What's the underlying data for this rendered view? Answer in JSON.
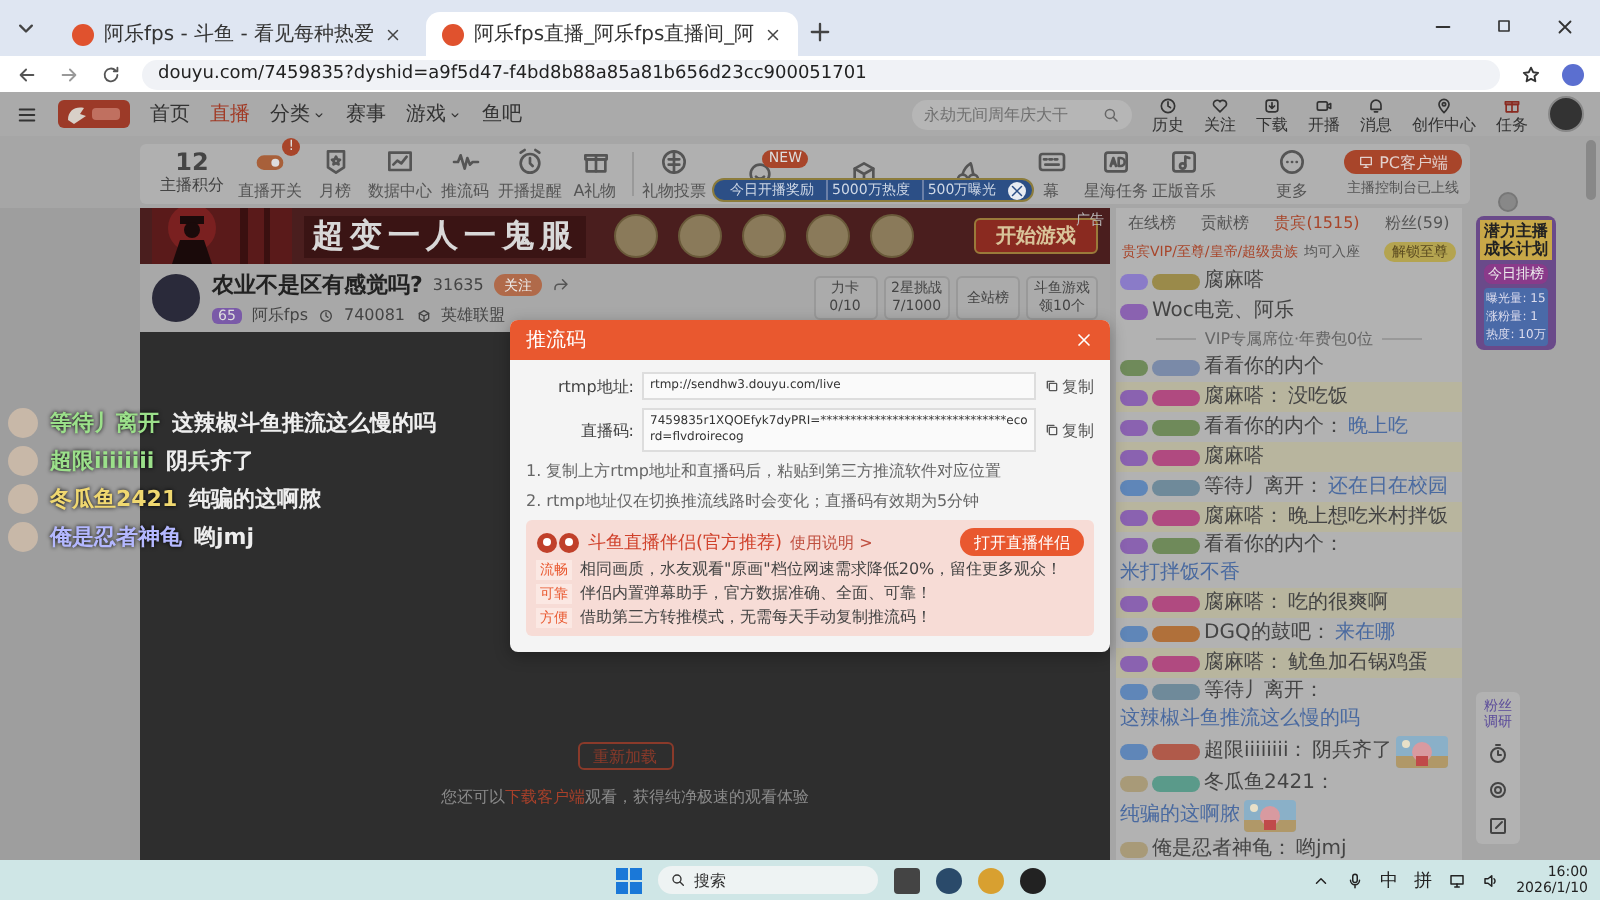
{
  "browser": {
    "tabs": [
      {
        "title": "阿乐fps - 斗鱼 - 看见每种热爱",
        "selected": false
      },
      {
        "title": "阿乐fps直播_阿乐fps直播间_阿",
        "selected": true
      }
    ],
    "url": "douyu.com/7459835?dyshid=a9f5d47-f4bd8b88a85a81b656d23cc900051701"
  },
  "site_header": {
    "nav": [
      {
        "label": "首页",
        "selected": false,
        "dropdown": false
      },
      {
        "label": "直播",
        "selected": true,
        "dropdown": false
      },
      {
        "label": "分类",
        "selected": false,
        "dropdown": true
      },
      {
        "label": "赛事",
        "selected": false,
        "dropdown": false
      },
      {
        "label": "游戏",
        "selected": false,
        "dropdown": true
      },
      {
        "label": "鱼吧",
        "selected": false,
        "dropdown": false
      }
    ],
    "search": {
      "placeholder": "永劫无间周年庆大干"
    },
    "actions": [
      {
        "label": "历史",
        "kind": "clock"
      },
      {
        "label": "关注",
        "kind": "heart"
      },
      {
        "label": "下载",
        "kind": "download"
      },
      {
        "label": "开播",
        "kind": "camera"
      },
      {
        "label": "消息",
        "kind": "bell"
      },
      {
        "label": "创作中心",
        "kind": "pin"
      },
      {
        "label": "任务",
        "kind": "gift"
      }
    ]
  },
  "toolbar": {
    "score": {
      "value": "12",
      "label": "主播积分"
    },
    "items": [
      {
        "label": "直播开关",
        "kind": "toggle",
        "badge": "!"
      },
      {
        "label": "月榜",
        "kind": "medal"
      },
      {
        "label": "数据中心",
        "kind": "chart"
      },
      {
        "label": "推流码",
        "kind": "wave"
      },
      {
        "label": "开播提醒",
        "kind": "alarm"
      },
      {
        "label": "A礼物",
        "kind": "gift"
      },
      {
        "label": "礼物投票",
        "kind": "vote"
      },
      {
        "kind": "face",
        "badge": "NEW"
      },
      {
        "kind": "box"
      },
      {
        "kind": "cherries"
      },
      {
        "label": "幕",
        "kind": "keyboard"
      },
      {
        "label": "星海任务",
        "kind": "ad"
      },
      {
        "label": "正版音乐",
        "kind": "music"
      }
    ],
    "popup": [
      "今日开播奖励",
      "5000万热度",
      "500万曝光"
    ],
    "more": "更多",
    "pc_button": "PC客户端",
    "pc_note": "主播控制台已上线"
  },
  "banner": {
    "title": "超变一人一鬼服",
    "button": "开始游戏",
    "ad_label": "广告"
  },
  "streamer": {
    "title": "农业不是区有感觉吗?",
    "followers": "31635",
    "follow_button": "关注",
    "level": "65",
    "name": "阿乐fps",
    "viewers": "740081",
    "category": "英雄联盟",
    "stats": [
      {
        "label": "力卡",
        "value": "0/10"
      },
      {
        "label": "2星挑战",
        "value": "7/1000"
      },
      {
        "label": "全站榜"
      },
      {
        "label": "斗鱼游戏",
        "value": "领10个"
      }
    ]
  },
  "danmu": [
    {
      "user": "等待丿离开",
      "message": "这辣椒斗鱼推流这么慢的吗",
      "color": "#9be08a"
    },
    {
      "user": "超限iiiiiiii",
      "message": "阴兵齐了",
      "color": "#9be08a"
    },
    {
      "user": "冬瓜鱼2421",
      "message": "纯骗的这啊脓",
      "color": "#f0d870"
    },
    {
      "user": "俺是忍者神龟",
      "message": "哟jmj",
      "color": "#b4b8ff"
    }
  ],
  "player": {
    "reload_button": "重新加载",
    "hint_before": "您还可以",
    "hint_link": "下载客户端",
    "hint_after": "观看，获得纯净极速的观看体验"
  },
  "modal": {
    "title": "推流码",
    "fields": [
      {
        "label": "rtmp地址:",
        "value": "rtmp://sendhw3.douyu.com/live",
        "copy": "复制"
      },
      {
        "label": "直播码:",
        "value": "7459835r1XQOEfyk7dyPRI=*******************************ecord=flvdroirecog",
        "copy": "复制"
      }
    ],
    "notes": [
      "1. 复制上方rtmp地址和直播码后，粘贴到第三方推流软件对应位置",
      "2. rtmp地址仅在切换推流线路时会变化；直播码有效期为5分钟"
    ],
    "promo": {
      "title": "斗鱼直播伴侣(官方推荐)",
      "help": "使用说明 >",
      "button": "打开直播伴侣",
      "features": [
        {
          "tag": "流畅",
          "text": "相同画质，水友观看\"原画\"档位网速需求降低20%，留住更多观众！"
        },
        {
          "tag": "可靠",
          "text": "伴侣内置弹幕助手，官方数据准确、全面、可靠！"
        },
        {
          "tag": "方便",
          "text": "借助第三方转推模式，无需每天手动复制推流码！"
        }
      ]
    }
  },
  "chat": {
    "tabs": [
      {
        "label": "在线榜",
        "selected": false
      },
      {
        "label": "贡献榜",
        "selected": false
      },
      {
        "label": "贵宾(1515)",
        "selected": true
      },
      {
        "label": "粉丝(59)",
        "selected": false
      }
    ],
    "notice": "贵宾VIP/至尊/皇帝/超级贵族",
    "notice_tail": "均可入座",
    "unlock_button": "解锁至尊",
    "messages": [
      {
        "kind": "enter",
        "user": "腐麻嗒",
        "badges": [
          {
            "color": "#8a7bc8"
          },
          {
            "color": "#9a8a4a"
          }
        ],
        "vip": false
      },
      {
        "kind": "enter",
        "user": "Woc电竞、阿乐",
        "badges": [
          {
            "color": "#8a62b0"
          }
        ],
        "vip": false
      },
      {
        "kind": "divider",
        "text": "VIP专属席位·年费包0位"
      },
      {
        "kind": "message",
        "user": "看看你的内个",
        "badges": [
          {
            "color": "#6f8a5a"
          },
          {
            "color": "#7a8aa8"
          }
        ],
        "vip": false
      },
      {
        "kind": "message",
        "user": "腐麻嗒：",
        "text": "没吃饭",
        "badges": [
          {
            "color": "#8a62b0"
          },
          {
            "color": "#b04a80"
          }
        ],
        "highlight": false,
        "vip": true
      },
      {
        "kind": "message",
        "user": "看看你的内个：",
        "text": "晚上吃",
        "badges": [
          {
            "color": "#8a62b0"
          },
          {
            "color": "#6f8a5a"
          }
        ],
        "highlight": true
      },
      {
        "kind": "message",
        "user": "腐麻嗒",
        "badges": [
          {
            "color": "#8a62b0"
          },
          {
            "color": "#b04a80"
          }
        ],
        "vip": true
      },
      {
        "kind": "message",
        "user": "等待丿离开：",
        "text": "还在日在校园",
        "badges": [
          {
            "color": "#5f86b8"
          },
          {
            "color": "#6f8a9a"
          }
        ],
        "highlight": true
      },
      {
        "kind": "message",
        "user": "腐麻嗒：",
        "text": "晚上想吃米村拌饭",
        "badges": [
          {
            "color": "#8a62b0"
          },
          {
            "color": "#b04a80"
          }
        ],
        "highlight": false,
        "vip": true
      },
      {
        "kind": "message",
        "user": "看看你的内个：",
        "text": "米打拌饭不香",
        "badges": [
          {
            "color": "#8a62b0"
          },
          {
            "color": "#6f8a5a"
          }
        ],
        "highlight": true
      },
      {
        "kind": "message",
        "user": "腐麻嗒：",
        "text": "吃的很爽啊",
        "badges": [
          {
            "color": "#8a62b0"
          },
          {
            "color": "#b04a80"
          }
        ],
        "highlight": false,
        "vip": true
      },
      {
        "kind": "message",
        "user": "DGQ的鼓吧：",
        "text": "来在哪",
        "badges": [
          {
            "color": "#5f86b8"
          },
          {
            "color": "#b0703a"
          }
        ],
        "highlight": true
      },
      {
        "kind": "message",
        "user": "腐麻嗒：",
        "text": "鱿鱼加石锅鸡蛋",
        "badges": [
          {
            "color": "#8a62b0"
          },
          {
            "color": "#b04a80"
          }
        ],
        "highlight": false,
        "vip": true
      },
      {
        "kind": "message",
        "user": "等待丿离开：",
        "text": "这辣椒斗鱼推流这么慢的吗",
        "badges": [
          {
            "color": "#5f86b8"
          },
          {
            "color": "#6f8a9a"
          }
        ],
        "highlight": true
      },
      {
        "kind": "message",
        "user": "超限iiiiiiii：",
        "text": "阴兵齐了",
        "badges": [
          {
            "color": "#5f86b8"
          },
          {
            "color": "#b05a4a"
          }
        ],
        "highlight": false,
        "sticker": true
      },
      {
        "kind": "message",
        "user": "冬瓜鱼2421：",
        "text": "纯骗的这啊脓",
        "badges": [
          {
            "color": "#a89a78"
          },
          {
            "color": "#5a9a8a"
          }
        ],
        "highlight": true,
        "sticker": true
      },
      {
        "kind": "message",
        "user": "俺是忍者神龟：",
        "text": "哟jmj",
        "badges": [
          {
            "color": "#a89a78"
          }
        ],
        "highlight": false
      }
    ]
  },
  "side_widget": {
    "title": "潜力主播成长计划",
    "tag": "今日排榜",
    "stats": [
      "曝光量: 15",
      "涨粉量: 1",
      "热度: 10万"
    ]
  },
  "side_tools": {
    "survey": "粉丝调研"
  },
  "taskbar": {
    "search": "搜索",
    "ime": [
      "中",
      "拼"
    ],
    "time": "16:00",
    "date": "2026/1/10"
  }
}
